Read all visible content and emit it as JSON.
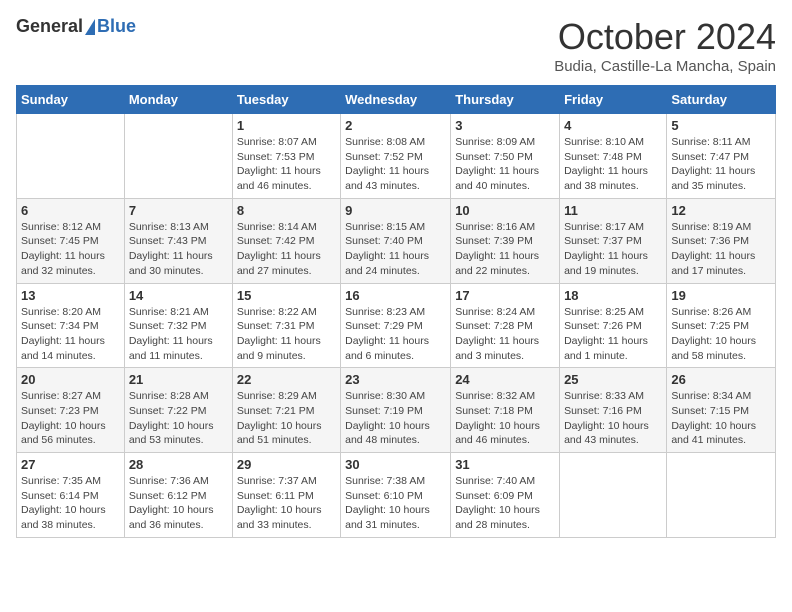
{
  "header": {
    "logo_general": "General",
    "logo_blue": "Blue",
    "month_title": "October 2024",
    "location": "Budia, Castille-La Mancha, Spain"
  },
  "days_of_week": [
    "Sunday",
    "Monday",
    "Tuesday",
    "Wednesday",
    "Thursday",
    "Friday",
    "Saturday"
  ],
  "weeks": [
    [
      {
        "day": "",
        "info": ""
      },
      {
        "day": "",
        "info": ""
      },
      {
        "day": "1",
        "info": "Sunrise: 8:07 AM\nSunset: 7:53 PM\nDaylight: 11 hours and 46 minutes."
      },
      {
        "day": "2",
        "info": "Sunrise: 8:08 AM\nSunset: 7:52 PM\nDaylight: 11 hours and 43 minutes."
      },
      {
        "day": "3",
        "info": "Sunrise: 8:09 AM\nSunset: 7:50 PM\nDaylight: 11 hours and 40 minutes."
      },
      {
        "day": "4",
        "info": "Sunrise: 8:10 AM\nSunset: 7:48 PM\nDaylight: 11 hours and 38 minutes."
      },
      {
        "day": "5",
        "info": "Sunrise: 8:11 AM\nSunset: 7:47 PM\nDaylight: 11 hours and 35 minutes."
      }
    ],
    [
      {
        "day": "6",
        "info": "Sunrise: 8:12 AM\nSunset: 7:45 PM\nDaylight: 11 hours and 32 minutes."
      },
      {
        "day": "7",
        "info": "Sunrise: 8:13 AM\nSunset: 7:43 PM\nDaylight: 11 hours and 30 minutes."
      },
      {
        "day": "8",
        "info": "Sunrise: 8:14 AM\nSunset: 7:42 PM\nDaylight: 11 hours and 27 minutes."
      },
      {
        "day": "9",
        "info": "Sunrise: 8:15 AM\nSunset: 7:40 PM\nDaylight: 11 hours and 24 minutes."
      },
      {
        "day": "10",
        "info": "Sunrise: 8:16 AM\nSunset: 7:39 PM\nDaylight: 11 hours and 22 minutes."
      },
      {
        "day": "11",
        "info": "Sunrise: 8:17 AM\nSunset: 7:37 PM\nDaylight: 11 hours and 19 minutes."
      },
      {
        "day": "12",
        "info": "Sunrise: 8:19 AM\nSunset: 7:36 PM\nDaylight: 11 hours and 17 minutes."
      }
    ],
    [
      {
        "day": "13",
        "info": "Sunrise: 8:20 AM\nSunset: 7:34 PM\nDaylight: 11 hours and 14 minutes."
      },
      {
        "day": "14",
        "info": "Sunrise: 8:21 AM\nSunset: 7:32 PM\nDaylight: 11 hours and 11 minutes."
      },
      {
        "day": "15",
        "info": "Sunrise: 8:22 AM\nSunset: 7:31 PM\nDaylight: 11 hours and 9 minutes."
      },
      {
        "day": "16",
        "info": "Sunrise: 8:23 AM\nSunset: 7:29 PM\nDaylight: 11 hours and 6 minutes."
      },
      {
        "day": "17",
        "info": "Sunrise: 8:24 AM\nSunset: 7:28 PM\nDaylight: 11 hours and 3 minutes."
      },
      {
        "day": "18",
        "info": "Sunrise: 8:25 AM\nSunset: 7:26 PM\nDaylight: 11 hours and 1 minute."
      },
      {
        "day": "19",
        "info": "Sunrise: 8:26 AM\nSunset: 7:25 PM\nDaylight: 10 hours and 58 minutes."
      }
    ],
    [
      {
        "day": "20",
        "info": "Sunrise: 8:27 AM\nSunset: 7:23 PM\nDaylight: 10 hours and 56 minutes."
      },
      {
        "day": "21",
        "info": "Sunrise: 8:28 AM\nSunset: 7:22 PM\nDaylight: 10 hours and 53 minutes."
      },
      {
        "day": "22",
        "info": "Sunrise: 8:29 AM\nSunset: 7:21 PM\nDaylight: 10 hours and 51 minutes."
      },
      {
        "day": "23",
        "info": "Sunrise: 8:30 AM\nSunset: 7:19 PM\nDaylight: 10 hours and 48 minutes."
      },
      {
        "day": "24",
        "info": "Sunrise: 8:32 AM\nSunset: 7:18 PM\nDaylight: 10 hours and 46 minutes."
      },
      {
        "day": "25",
        "info": "Sunrise: 8:33 AM\nSunset: 7:16 PM\nDaylight: 10 hours and 43 minutes."
      },
      {
        "day": "26",
        "info": "Sunrise: 8:34 AM\nSunset: 7:15 PM\nDaylight: 10 hours and 41 minutes."
      }
    ],
    [
      {
        "day": "27",
        "info": "Sunrise: 7:35 AM\nSunset: 6:14 PM\nDaylight: 10 hours and 38 minutes."
      },
      {
        "day": "28",
        "info": "Sunrise: 7:36 AM\nSunset: 6:12 PM\nDaylight: 10 hours and 36 minutes."
      },
      {
        "day": "29",
        "info": "Sunrise: 7:37 AM\nSunset: 6:11 PM\nDaylight: 10 hours and 33 minutes."
      },
      {
        "day": "30",
        "info": "Sunrise: 7:38 AM\nSunset: 6:10 PM\nDaylight: 10 hours and 31 minutes."
      },
      {
        "day": "31",
        "info": "Sunrise: 7:40 AM\nSunset: 6:09 PM\nDaylight: 10 hours and 28 minutes."
      },
      {
        "day": "",
        "info": ""
      },
      {
        "day": "",
        "info": ""
      }
    ]
  ]
}
